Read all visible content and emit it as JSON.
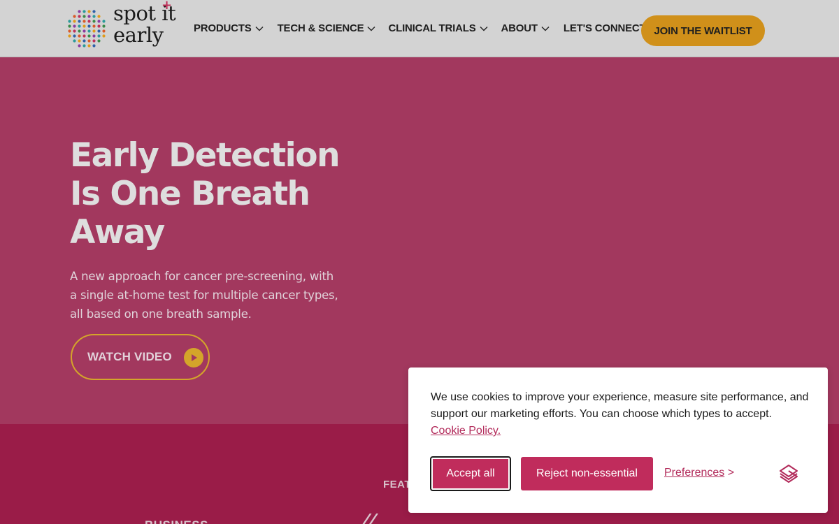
{
  "header": {
    "logo": {
      "line1": "spot it",
      "line2": "early",
      "plus": "+"
    },
    "nav": [
      {
        "label": "PRODUCTS",
        "has_dropdown": true
      },
      {
        "label": "TECH & SCIENCE",
        "has_dropdown": true
      },
      {
        "label": "CLINICAL TRIALS",
        "has_dropdown": true
      },
      {
        "label": "ABOUT",
        "has_dropdown": true
      },
      {
        "label": "LET'S CONNECT",
        "has_dropdown": false
      }
    ],
    "cta_label": "JOIN THE WAITLIST"
  },
  "hero": {
    "title_lines": [
      "Early Detection",
      "Is One Breath",
      "Away"
    ],
    "subtitle_lines": [
      "A new approach for cancer pre-screening, with",
      "a single at-home test for multiple cancer types,",
      "all based on one breath sample."
    ],
    "watch_label": "WATCH VIDEO"
  },
  "band": {
    "featured_partial": "FEAT",
    "business_partial": "BUSINESS",
    "slash_partial": "//"
  },
  "cookie_banner": {
    "text": "We use cookies to improve your experience, measure site performance, and support our marketing efforts. You can choose which types to accept.",
    "policy_link": "Cookie Policy.",
    "accept_label": "Accept all",
    "reject_label": "Reject non-essential",
    "preferences_label": "Preferences",
    "preferences_suffix": ">"
  },
  "colors": {
    "header_bg": "#d3d3d3",
    "hero_bg": "#a2385e",
    "band_bg": "#9a1c48",
    "gold": "#d0901a",
    "cookie_button": "#c02c5c",
    "link": "#b22a5a"
  },
  "icons": {
    "logo": "dot-grid-logo",
    "dropdown": "chevron-down-icon",
    "play": "play-icon",
    "cookie_brand": "cookie-provider-icon"
  }
}
